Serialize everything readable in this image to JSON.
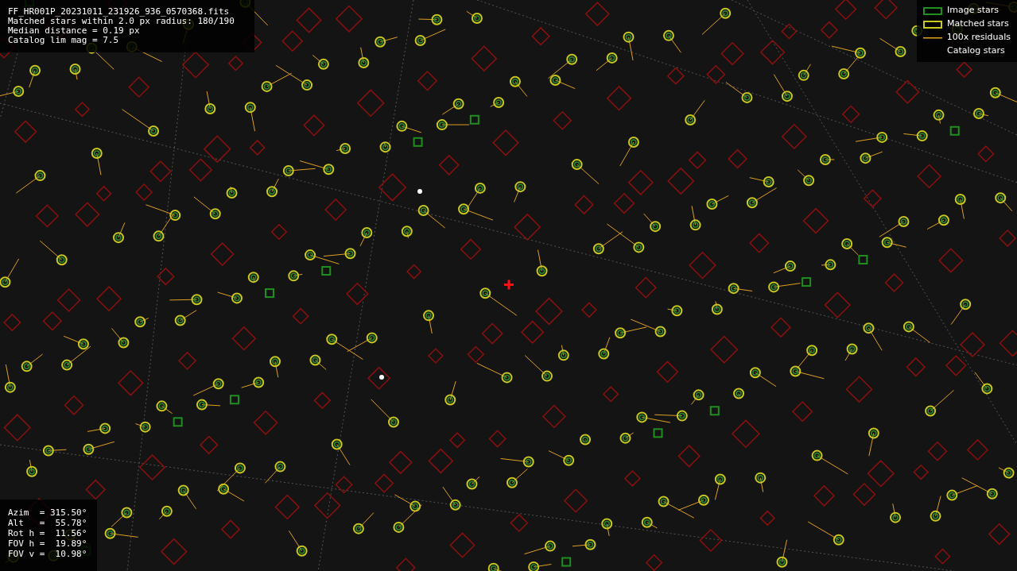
{
  "header": {
    "lines": [
      "FF_HR001P_20231011_231926_936_0570368.fits",
      "Matched stars within 2.0 px radius: 180/190",
      "Median distance = 0.19 px",
      "Catalog lim mag = 7.5"
    ]
  },
  "legend": [
    {
      "kind": "image",
      "label": "Image stars"
    },
    {
      "kind": "matched",
      "label": "Matched stars"
    },
    {
      "kind": "residual",
      "label": "100x residuals"
    },
    {
      "kind": "catalog",
      "label": "Catalog stars"
    }
  ],
  "pointing": {
    "lines": [
      "Azim  = 315.50°",
      "Alt   =  55.78°",
      "Rot h =  11.56°",
      "FOV h =  19.89°",
      "FOV v =  10.98°"
    ]
  }
}
